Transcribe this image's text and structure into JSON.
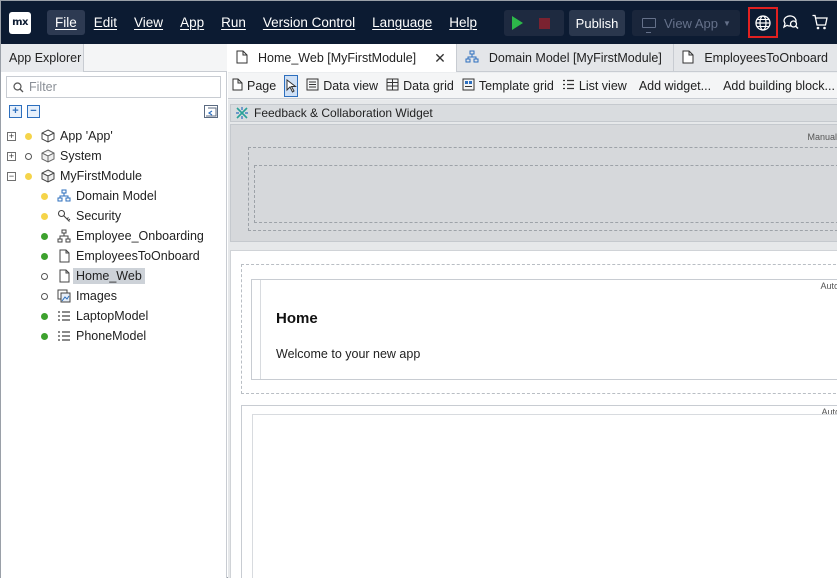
{
  "app": {
    "logo_text": "mx",
    "menu": [
      "File",
      "Edit",
      "View",
      "App",
      "Run",
      "Version Control",
      "Language",
      "Help"
    ],
    "publish_label": "Publish",
    "view_app_label": "View App"
  },
  "explorer": {
    "tab_label": "App Explorer",
    "filter_placeholder": "Filter",
    "tree": [
      {
        "label": "App 'App'",
        "expander": "+",
        "status": "yellow",
        "icon": "app-box-icon"
      },
      {
        "label": "System",
        "expander": "+",
        "status": "hollow",
        "icon": "module-box-icon"
      },
      {
        "label": "MyFirstModule",
        "expander": "-",
        "status": "yellow",
        "icon": "module-box-icon"
      },
      {
        "label": "Domain Model",
        "status": "yellow",
        "icon": "domain-model-icon"
      },
      {
        "label": "Security",
        "status": "yellow",
        "icon": "key-icon"
      },
      {
        "label": "Employee_Onboarding",
        "status": "green",
        "icon": "workflow-icon"
      },
      {
        "label": "EmployeesToOnboard",
        "status": "green",
        "icon": "page-icon"
      },
      {
        "label": "Home_Web",
        "status": "hollow",
        "icon": "page-icon",
        "selected": true
      },
      {
        "label": "Images",
        "status": "hollow",
        "icon": "images-icon"
      },
      {
        "label": "LaptopModel",
        "status": "green",
        "icon": "enumeration-icon"
      },
      {
        "label": "PhoneModel",
        "status": "green",
        "icon": "enumeration-icon"
      }
    ]
  },
  "editor": {
    "tabs": [
      {
        "label": "Home_Web [MyFirstModule]",
        "icon": "page-icon",
        "active": true
      },
      {
        "label": "Domain Model [MyFirstModule]",
        "icon": "domain-model-icon",
        "active": false
      },
      {
        "label": "EmployeesToOnboard",
        "icon": "page-icon",
        "active": false
      }
    ],
    "toolbar": {
      "page": "Page",
      "data_view": "Data view",
      "data_grid": "Data grid",
      "template_grid": "Template grid",
      "list_view": "List view",
      "add_widget": "Add widget...",
      "add_building_block": "Add building block..."
    },
    "canvas": {
      "widget_header": "Feedback & Collaboration Widget",
      "manual_label": "Manual",
      "auto_label": "Auto",
      "home_title": "Home",
      "welcome_text": "Welcome to your new app"
    }
  },
  "colors": {
    "menubar_bg": "#0c1b32",
    "highlight_border": "#e02020",
    "run_green": "#2db84a",
    "status_green": "#3da12e",
    "status_yellow": "#f5d44a"
  }
}
